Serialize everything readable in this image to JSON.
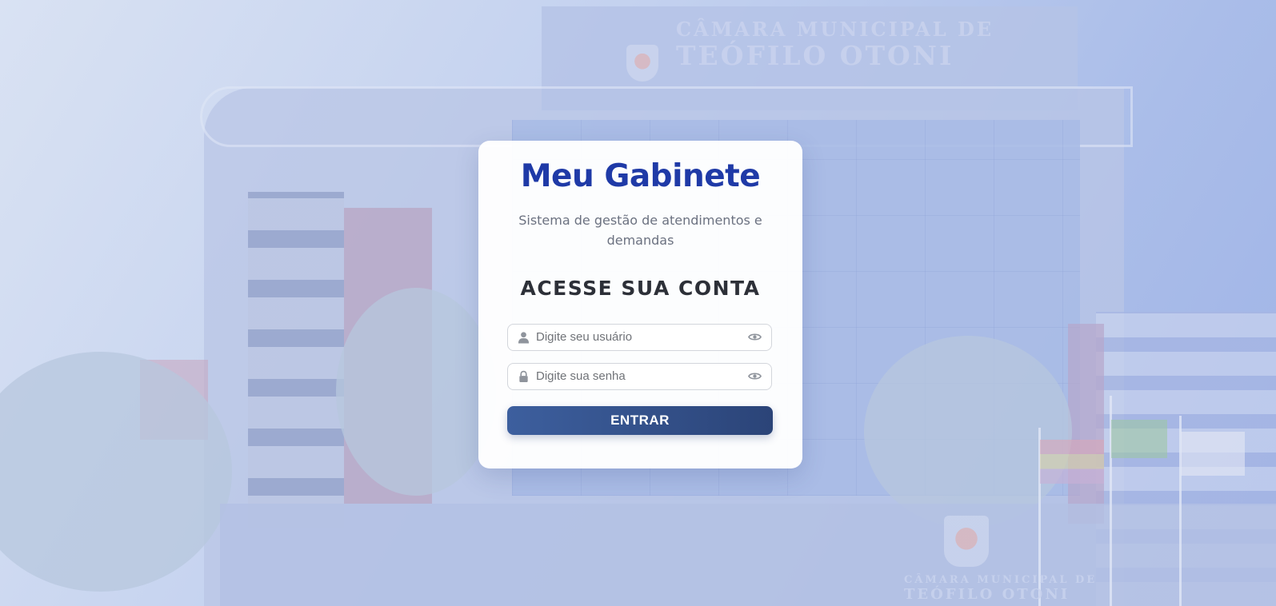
{
  "background": {
    "sign_line1": "CÂMARA MUNICIPAL DE",
    "sign_line2": "TEÓFILO OTONI",
    "ground_sign_line1": "CÂMARA MUNICIPAL DE",
    "ground_sign_line2": "TEÓFILO OTONI"
  },
  "login": {
    "app_title": "Meu Gabinete",
    "subtitle": "Sistema de gestão de atendimentos e demandas",
    "section_title": "ACESSE SUA CONTA",
    "username": {
      "value": "",
      "placeholder": "Digite seu usuário",
      "icon": "user-icon"
    },
    "password": {
      "value": "",
      "placeholder": "Digite sua senha",
      "icon": "lock-icon"
    },
    "visibility_icon": "eye-icon",
    "submit_label": "ENTRAR"
  },
  "colors": {
    "title": "#1f3aa7",
    "button_start": "#3d5f9e",
    "button_end": "#2b4478",
    "background_tint": "#aabde9"
  }
}
